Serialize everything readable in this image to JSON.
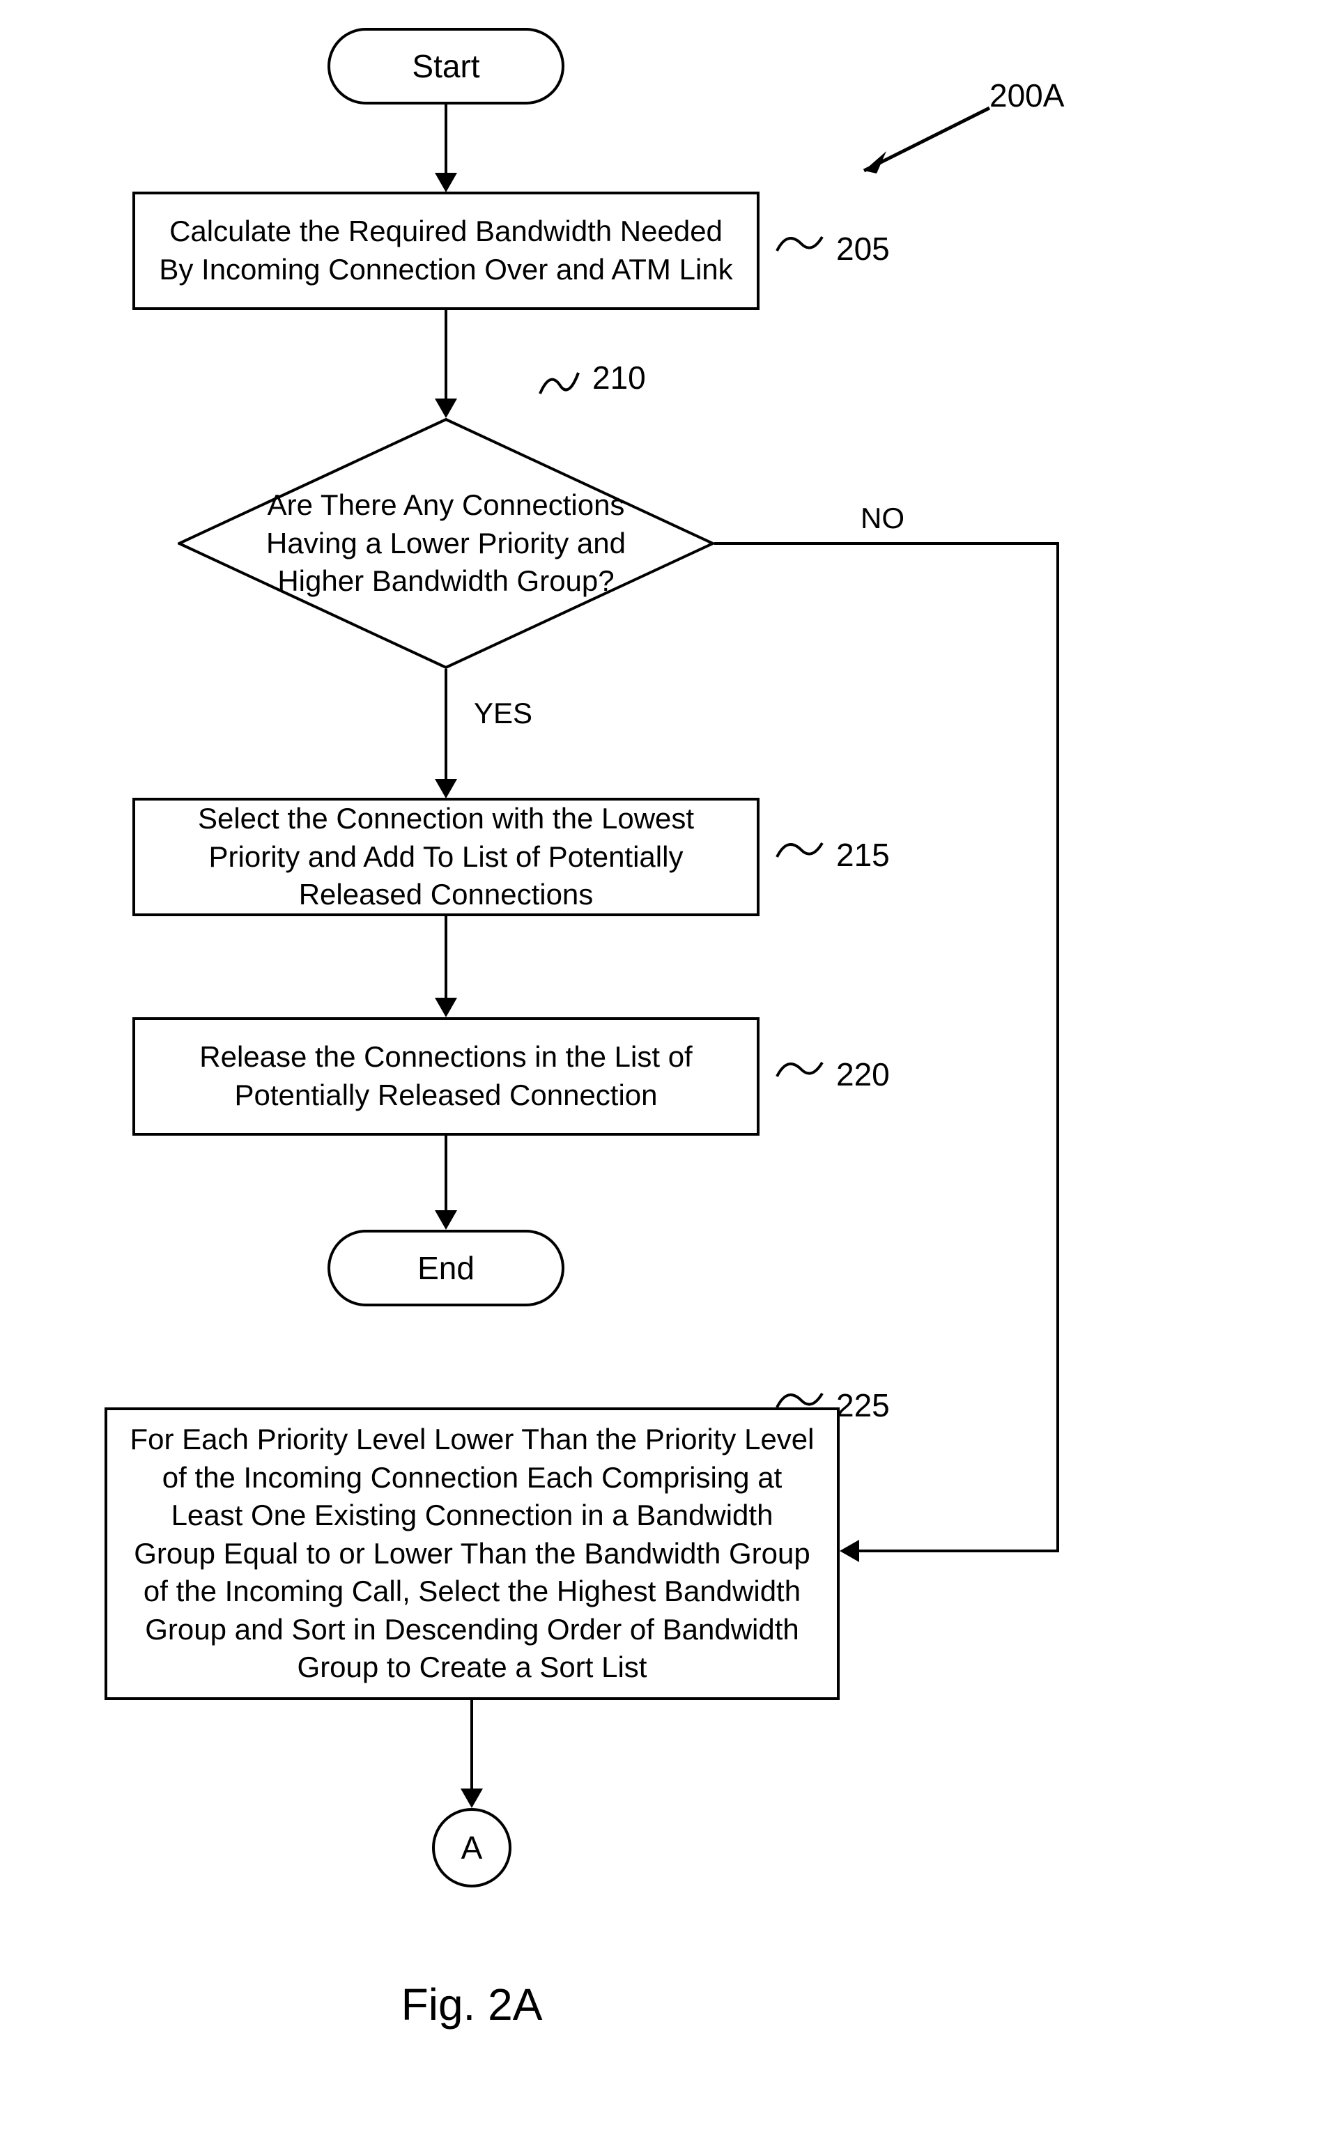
{
  "flow": {
    "start": "Start",
    "step1": "Calculate the Required Bandwidth Needed By Incoming Connection Over and ATM Link",
    "decision": "Are There Any Connections Having a Lower Priority and Higher Bandwidth Group?",
    "yes": "YES",
    "no": "NO",
    "step2": "Select the Connection with the Lowest Priority and Add To List of Potentially Released Connections",
    "step3": "Release the Connections in the List of Potentially Released Connection",
    "end": "End",
    "step4": "For Each Priority Level Lower Than the Priority Level of the Incoming Connection Each Comprising at Least One Existing Connection in a Bandwidth Group Equal to or Lower Than the Bandwidth Group of the Incoming Call, Select the Highest Bandwidth Group and Sort in Descending Order of Bandwidth Group to Create a Sort List",
    "connector": "A"
  },
  "refs": {
    "r200a": "200A",
    "r205": "205",
    "r210": "210",
    "r215": "215",
    "r220": "220",
    "r225": "225"
  },
  "figcaption": "Fig. 2A"
}
